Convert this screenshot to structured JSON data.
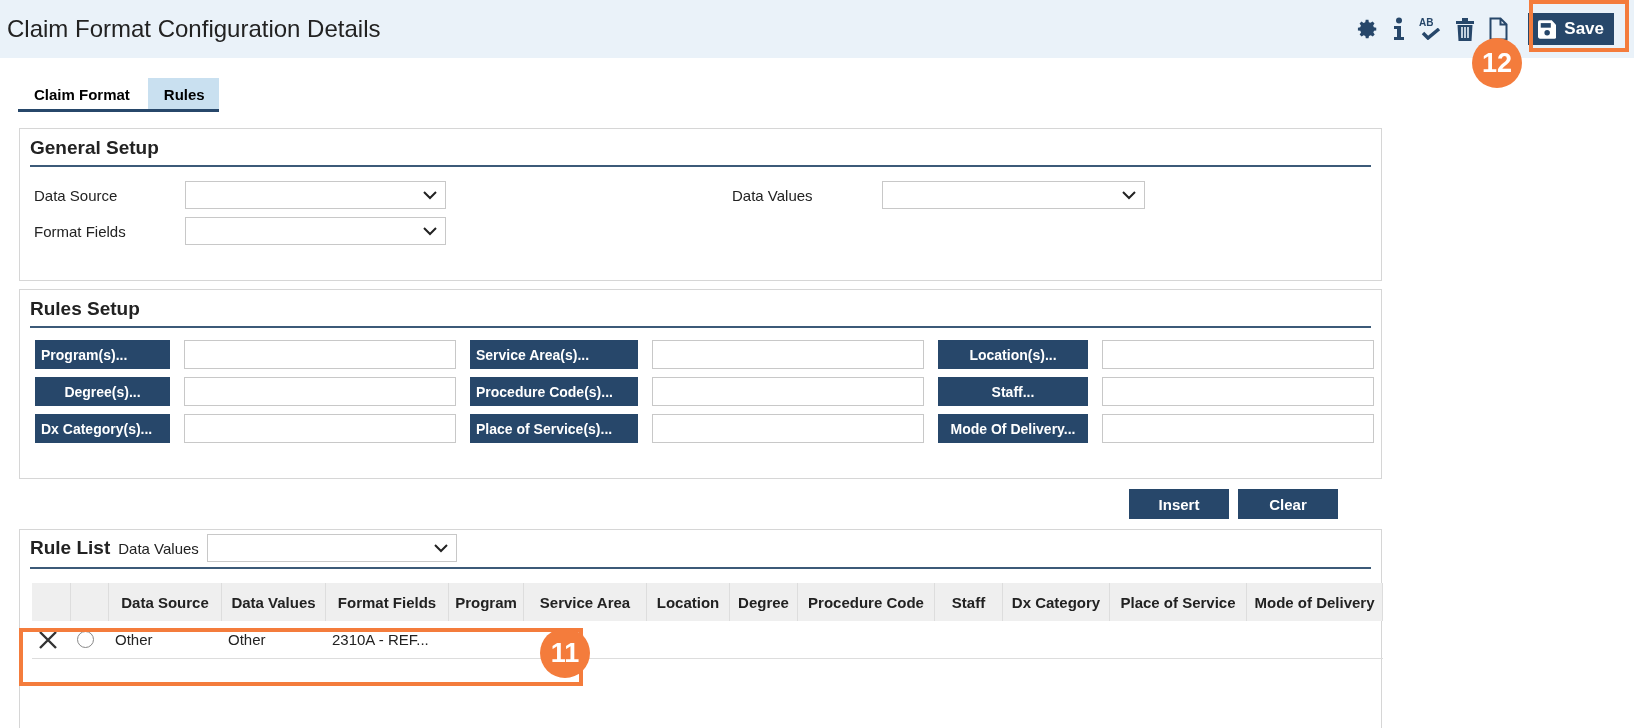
{
  "window": {
    "title": "Claim Format Configuration Details"
  },
  "toolbar": [
    {
      "kind": "settings"
    },
    {
      "kind": "info"
    },
    {
      "kind": "spellcheck",
      "label": "AB"
    },
    {
      "kind": "delete"
    },
    {
      "kind": "new"
    }
  ],
  "save_button": {
    "label": "Save"
  },
  "tabs": [
    {
      "label": "Claim Format",
      "selected": false
    },
    {
      "label": "Rules",
      "selected": true
    }
  ],
  "general_setup": {
    "title": "General Setup",
    "fields": [
      {
        "label": "Data Source"
      },
      {
        "label": "Data Values"
      },
      {
        "label": "Format Fields"
      }
    ]
  },
  "rules_setup": {
    "title": "Rules Setup",
    "pickers": [
      {
        "button": "Program(s)..."
      },
      {
        "button": "Service Area(s)..."
      },
      {
        "button": "Location(s)..."
      },
      {
        "button": "Degree(s)..."
      },
      {
        "button": "Procedure Code(s)..."
      },
      {
        "button": "Staff..."
      },
      {
        "button": "Dx Category(s)..."
      },
      {
        "button": "Place of Service(s)..."
      },
      {
        "button": "Mode Of Delivery..."
      }
    ]
  },
  "actions": [
    "Insert",
    "Clear"
  ],
  "rule_list": {
    "title": "Rule List",
    "filter_label": "Data Values",
    "columns": [
      "Data Source",
      "Data Values",
      "Format Fields",
      "Program",
      "Service Area",
      "Location",
      "Degree",
      "Procedure Code",
      "Staff",
      "Dx Category",
      "Place of Service",
      "Mode of Delivery"
    ],
    "rows": [
      {
        "selected": false,
        "cells": [
          "Other",
          "Other",
          "2310A - REF..."
        ]
      }
    ]
  },
  "annotations": [
    {
      "number": "12"
    },
    {
      "number": "11"
    }
  ]
}
